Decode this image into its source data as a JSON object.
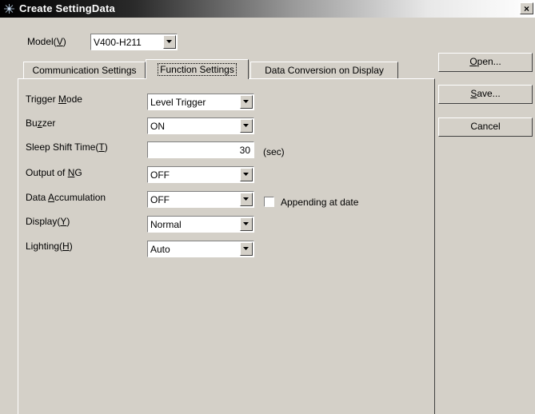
{
  "window": {
    "title": "Create SettingData",
    "close_glyph": "×"
  },
  "model": {
    "label": "Model(",
    "key": "V",
    "label_end": ")",
    "value": "V400-H211"
  },
  "tabs": [
    {
      "label": "Communication Settings"
    },
    {
      "label": "Function Settings"
    },
    {
      "label": "Data Conversion on Display"
    }
  ],
  "fields": {
    "trigger_mode": {
      "label_pre": "Trigger ",
      "key": "M",
      "label_post": "ode",
      "value": "Level Trigger"
    },
    "buzzer": {
      "label_pre": "Bu",
      "key": "z",
      "label_post": "zer",
      "value": "ON"
    },
    "sleep_shift_time": {
      "label_pre": "Sleep Shift Time(",
      "key": "T",
      "label_post": ")",
      "value": "30",
      "unit": "(sec)"
    },
    "output_of_ng": {
      "label_pre": "Output of ",
      "key": "N",
      "label_post": "G",
      "value": "OFF"
    },
    "data_accumulation": {
      "label_pre": "Data ",
      "key": "A",
      "label_post": "ccumulation",
      "value": "OFF",
      "checkbox_label": "Appending at date"
    },
    "display": {
      "label_pre": "Display(",
      "key": "Y",
      "label_post": ")",
      "value": "Normal"
    },
    "lighting": {
      "label_pre": "Lighting(",
      "key": "H",
      "label_post": ")",
      "value": "Auto"
    }
  },
  "buttons": {
    "open": {
      "key": "O",
      "rest": "pen..."
    },
    "save": {
      "key": "S",
      "rest": "ave..."
    },
    "cancel": {
      "label": "Cancel"
    }
  }
}
